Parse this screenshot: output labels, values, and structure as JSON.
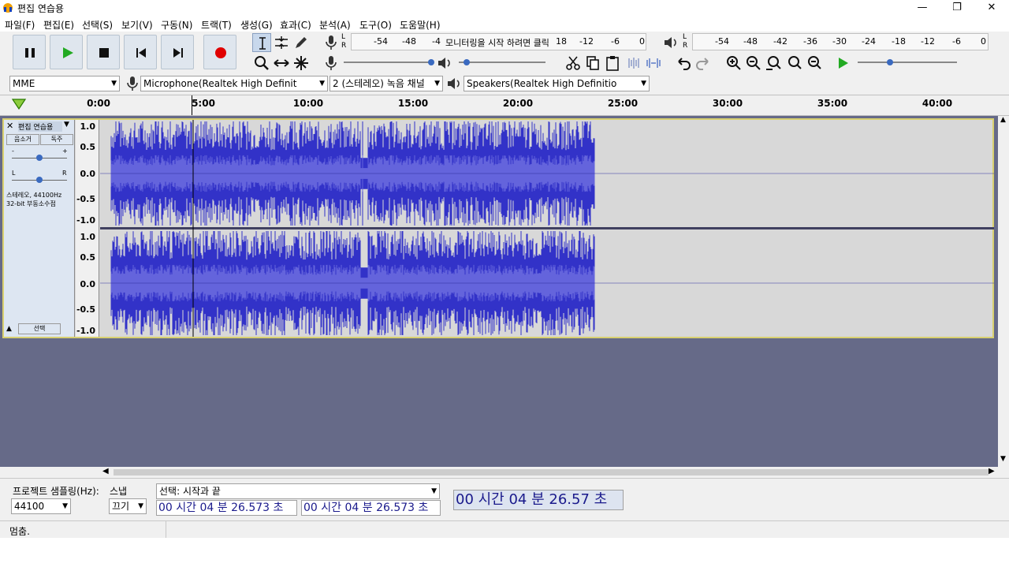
{
  "window": {
    "title": "편집 연습용",
    "min": "—",
    "restore": "❐",
    "close": "✕"
  },
  "menu": [
    "파일(F)",
    "편집(E)",
    "선택(S)",
    "보기(V)",
    "구동(N)",
    "트랙(T)",
    "생성(G)",
    "효과(C)",
    "분석(A)",
    "도구(O)",
    "도움말(H)"
  ],
  "meter": {
    "record_ticks": [
      "-54",
      "-48",
      "-4",
      "모니터링을 시작 하려면 클릭",
      "18",
      "-12",
      "-6",
      "0"
    ],
    "play_ticks": [
      "-54",
      "-48",
      "-42",
      "-36",
      "-30",
      "-24",
      "-18",
      "-12",
      "-6",
      "0"
    ],
    "L": "L",
    "R": "R"
  },
  "device": {
    "host": "MME",
    "mic": "Microphone(Realtek High Definit",
    "channels": "2 (스테레오) 녹음 채널",
    "speaker": "Speakers(Realtek High Definitio"
  },
  "timeline": {
    "labels": [
      "0:00",
      "5:00",
      "10:00",
      "15:00",
      "20:00",
      "25:00",
      "30:00",
      "35:00",
      "40:00"
    ]
  },
  "track": {
    "name": "편집 연습용",
    "mute": "음소거",
    "solo": "독주",
    "gain_minus": "-",
    "gain_plus": "+",
    "pan_l": "L",
    "pan_r": "R",
    "info1": "스테레오, 44100Hz",
    "info2": "32-bit 부동소수점",
    "select": "선택",
    "scale": [
      "1.0",
      "0.5",
      "0.0",
      "-0.5",
      "-1.0"
    ]
  },
  "bottom": {
    "rate_label": "프로젝트 샘플링(Hz):",
    "rate_value": "44100",
    "snap_label": "스냅",
    "snap_value": "끄기",
    "selection_mode": "선택: 시작과 끝",
    "sel_start": "00 시간 04 분 26.573 초",
    "sel_end": "00 시간 04 분 26.573 초",
    "position": "00 시간 04 분 26.57 초"
  },
  "status": {
    "text": "멈춤."
  },
  "colors": {
    "wave": "#3232c8",
    "wave_light": "#6464dc",
    "track_bg": "#d8d8d8",
    "area_bg": "#666a88",
    "record": "#e00000",
    "play": "#22aa22"
  }
}
